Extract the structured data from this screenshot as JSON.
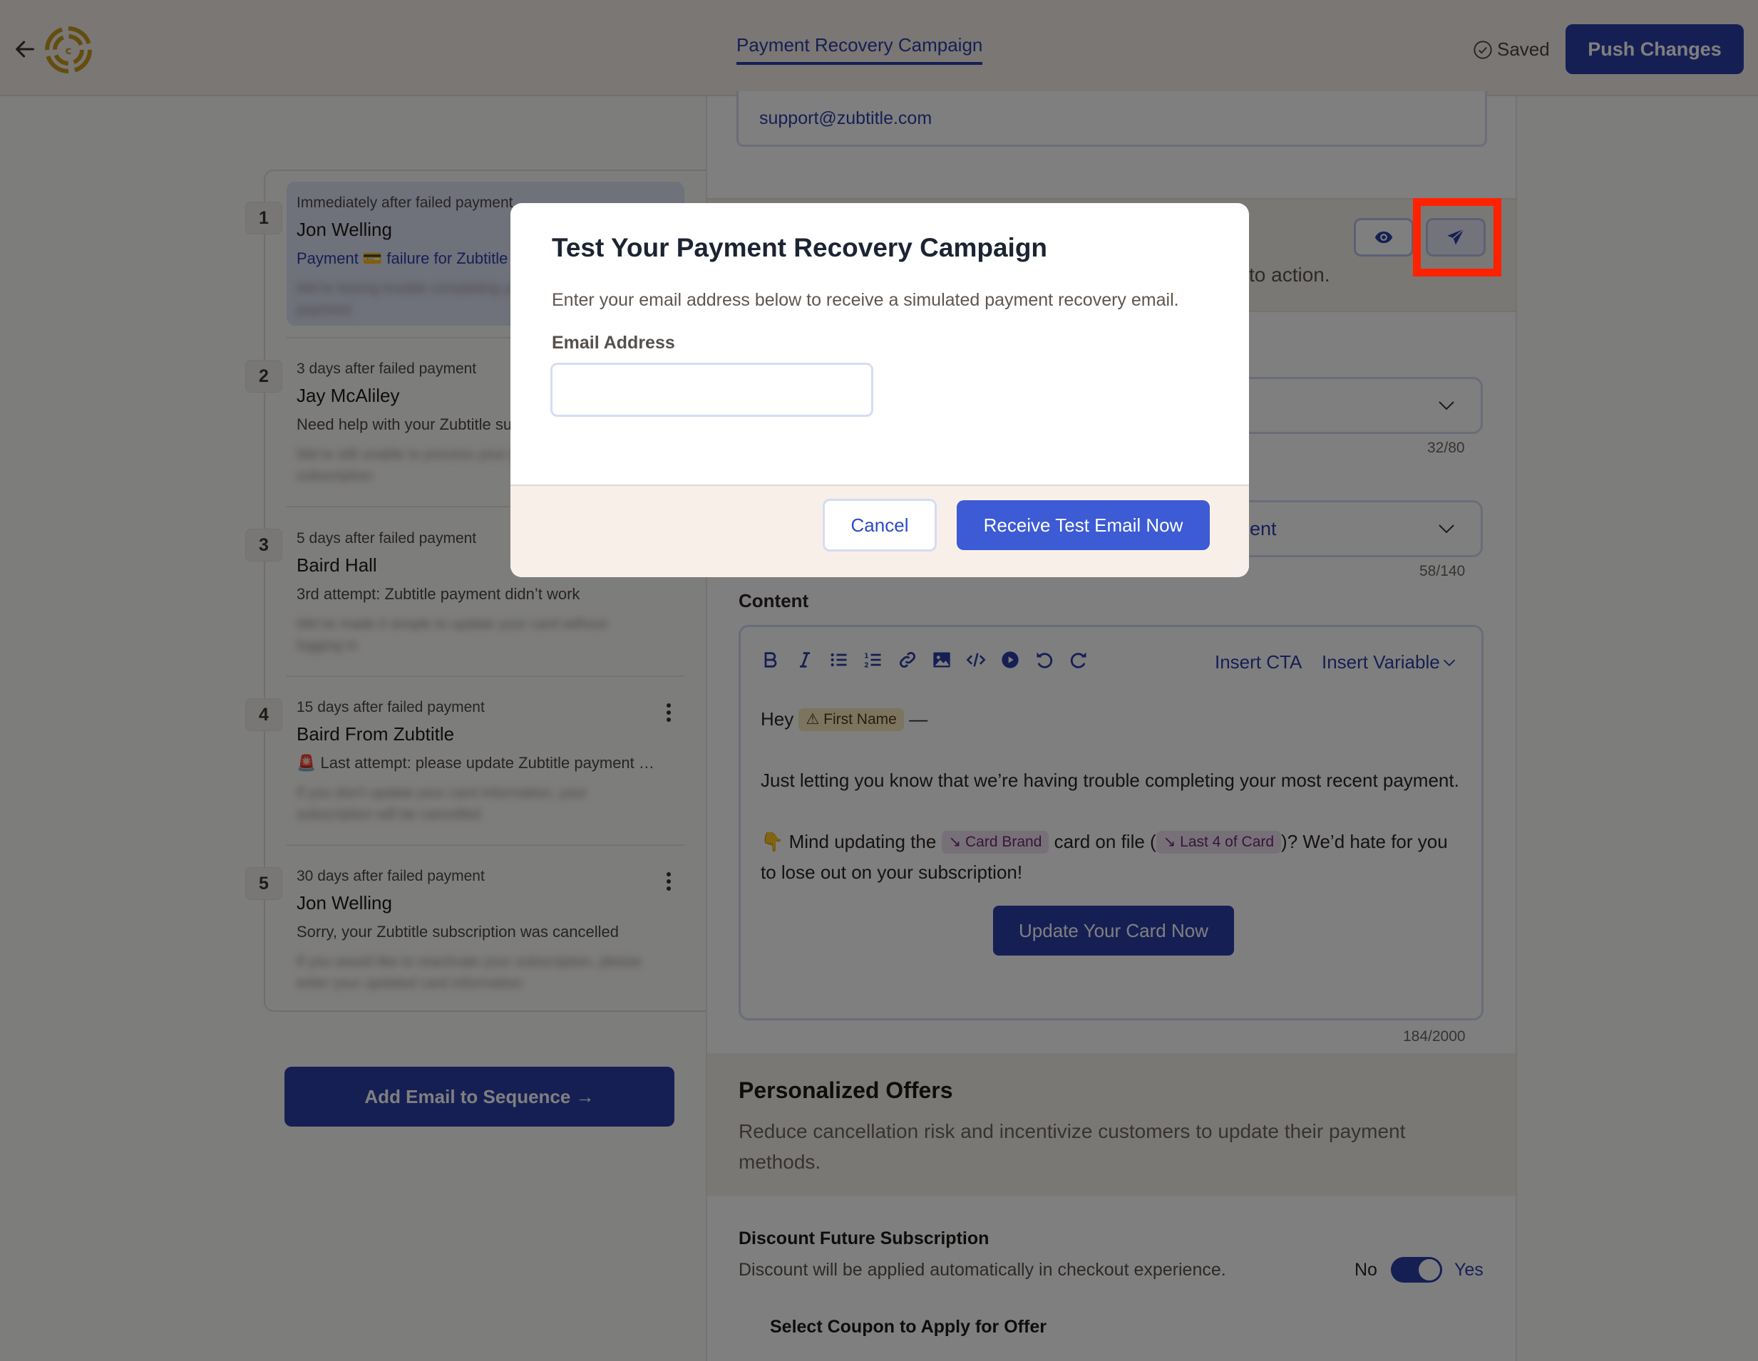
{
  "header": {
    "back_icon": "arrow-left-icon",
    "logo": "brand-logo",
    "title": "Payment Recovery Campaign",
    "saved_label": "Saved",
    "push_label": "Push Changes"
  },
  "sequence": {
    "steps": [
      {
        "number": "1",
        "timing": "Immediately after failed payment",
        "sender": "Jon Welling",
        "subject": "Payment 💳 failure for Zubtitle",
        "preview": "We're having trouble completing your most recent payment",
        "active": true
      },
      {
        "number": "2",
        "timing": "3 days after failed payment",
        "sender": "Jay McAliley",
        "subject": "Need help with your Zubtitle subscription?",
        "preview": "We're still unable to process your payment for your subscription"
      },
      {
        "number": "3",
        "timing": "5 days after failed payment",
        "sender": "Baird Hall",
        "subject": "3rd attempt: Zubtitle payment didn’t work",
        "preview": "We've made it simple to update your card without logging in"
      },
      {
        "number": "4",
        "timing": "15 days after failed payment",
        "sender": "Baird From Zubtitle",
        "subject": "🚨 Last attempt: please update Zubtitle payment …",
        "preview": "If you don't update your card information, your subscription will be cancelled"
      },
      {
        "number": "5",
        "timing": "30 days after failed payment",
        "sender": "Jon Welling",
        "subject": "Sorry, your Zubtitle subscription was cancelled",
        "preview": "If you would like to reactivate your subscription, please enter your updated card information"
      }
    ],
    "add_button": "Add Email to Sequence →"
  },
  "editor": {
    "reply_to": "support@zubtitle.com",
    "section_fragment": "to action.",
    "preview_icon": "eye-icon",
    "send_test_icon": "paper-plane-icon",
    "sender_counter": "32/80",
    "subject_fragment": "ent",
    "subject_counter": "58/140",
    "content_label": "Content",
    "toolbar": [
      "bold-icon",
      "italic-icon",
      "bullet-list-icon",
      "numbered-list-icon",
      "link-icon",
      "image-icon",
      "code-icon",
      "video-icon",
      "undo-icon",
      "redo-icon"
    ],
    "insert_cta": "Insert CTA",
    "insert_variable": "Insert Variable",
    "body": {
      "greeting": "Hey",
      "first_name_chip": "First Name",
      "greeting_end": "—",
      "para1": "Just letting you know that we’re having trouble completing your most recent payment.",
      "para2_emoji": "👇",
      "para2_a": "Mind updating the",
      "card_brand_chip": "Card Brand",
      "para2_b": "card on file (",
      "last4_chip": "Last 4 of Card",
      "para2_c": ")? We’d hate for you to lose out on your subscription!",
      "cta": "Update Your Card Now"
    },
    "content_counter": "184/2000"
  },
  "offers": {
    "title": "Personalized Offers",
    "description": "Reduce cancellation risk and incentivize customers to update their payment methods.",
    "discount_title": "Discount Future Subscription",
    "discount_desc": "Discount will be applied automatically in checkout experience.",
    "toggle_no": "No",
    "toggle_yes": "Yes",
    "toggle_state": "Yes",
    "coupon_label": "Select Coupon to Apply for Offer"
  },
  "modal": {
    "title": "Test Your Payment Recovery Campaign",
    "description": "Enter your email address below to receive a simulated payment recovery email.",
    "email_label": "Email Address",
    "email_value": "",
    "email_placeholder": "",
    "cancel": "Cancel",
    "submit": "Receive Test Email Now"
  },
  "colors": {
    "primary": "#2d3fa8",
    "modal_primary": "#3c5bd4",
    "highlight": "#ff2200",
    "logo": "#c99a1c"
  }
}
